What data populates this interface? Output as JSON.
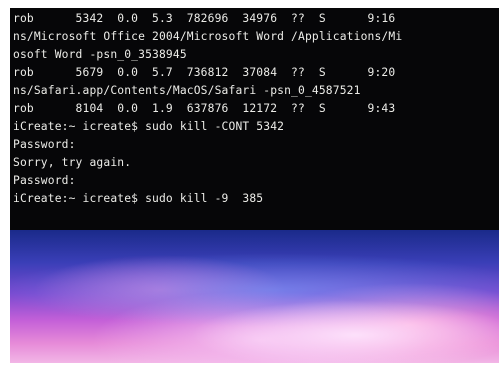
{
  "terminal": {
    "lines": [
      "rob      5342  0.0  5.3  782696  34976  ??  S      9:16",
      "ns/Microsoft Office 2004/Microsoft Word /Applications/Mi",
      "osoft Word -psn_0_3538945",
      "rob      5679  0.0  5.7  736812  37084  ??  S      9:20",
      "ns/Safari.app/Contents/MacOS/Safari -psn_0_4587521",
      "rob      8104  0.0  1.9  637876  12172  ??  S      9:43",
      "iCreate:~ icreate$ sudo kill -CONT 5342",
      "Password:",
      "Sorry, try again.",
      "Password:",
      "iCreate:~ icreate$ sudo kill -9  385"
    ]
  }
}
